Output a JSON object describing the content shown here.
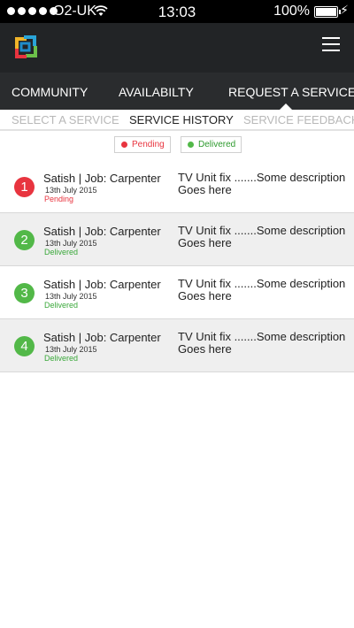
{
  "colors": {
    "pending": "#e8343f",
    "delivered": "#52b848",
    "header_bg": "#222426",
    "nav_bg": "#2a2c2e"
  },
  "status_bar": {
    "carrier": "O2-UK",
    "time": "13:03",
    "battery": "100%",
    "icons": [
      "signal-dots-icon",
      "wifi-icon",
      "battery-icon",
      "charging-icon"
    ]
  },
  "header": {
    "logo": "app-logo-icon",
    "menu": "hamburger-menu-icon"
  },
  "main_nav": {
    "items": [
      {
        "label": "COMMUNITY"
      },
      {
        "label": "AVAILABILTY"
      },
      {
        "label": "REQUEST A SERVICE",
        "active": true
      }
    ]
  },
  "sub_nav": {
    "items": [
      {
        "label": "SELECT A SERVICE"
      },
      {
        "label": "SERVICE HISTORY",
        "active": true
      },
      {
        "label": "SERVICE FEEDBACK"
      }
    ]
  },
  "legend": {
    "pending": "Pending",
    "delivered": "Delivered"
  },
  "history": [
    {
      "number": "1",
      "title": "Satish | Job: Carpenter",
      "date": "13th July 2015",
      "status": "Pending",
      "description": "TV Unit fix .......Some description Goes here"
    },
    {
      "number": "2",
      "title": "Satish | Job: Carpenter",
      "date": "13th July 2015",
      "status": "Delivered",
      "description": "TV Unit fix .......Some description Goes here"
    },
    {
      "number": "3",
      "title": "Satish | Job: Carpenter",
      "date": "13th July 2015",
      "status": "Delivered",
      "description": "TV Unit fix .......Some description Goes here"
    },
    {
      "number": "4",
      "title": "Satish | Job: Carpenter",
      "date": "13th July 2015",
      "status": "Delivered",
      "description": "TV Unit fix .......Some description Goes here"
    }
  ]
}
